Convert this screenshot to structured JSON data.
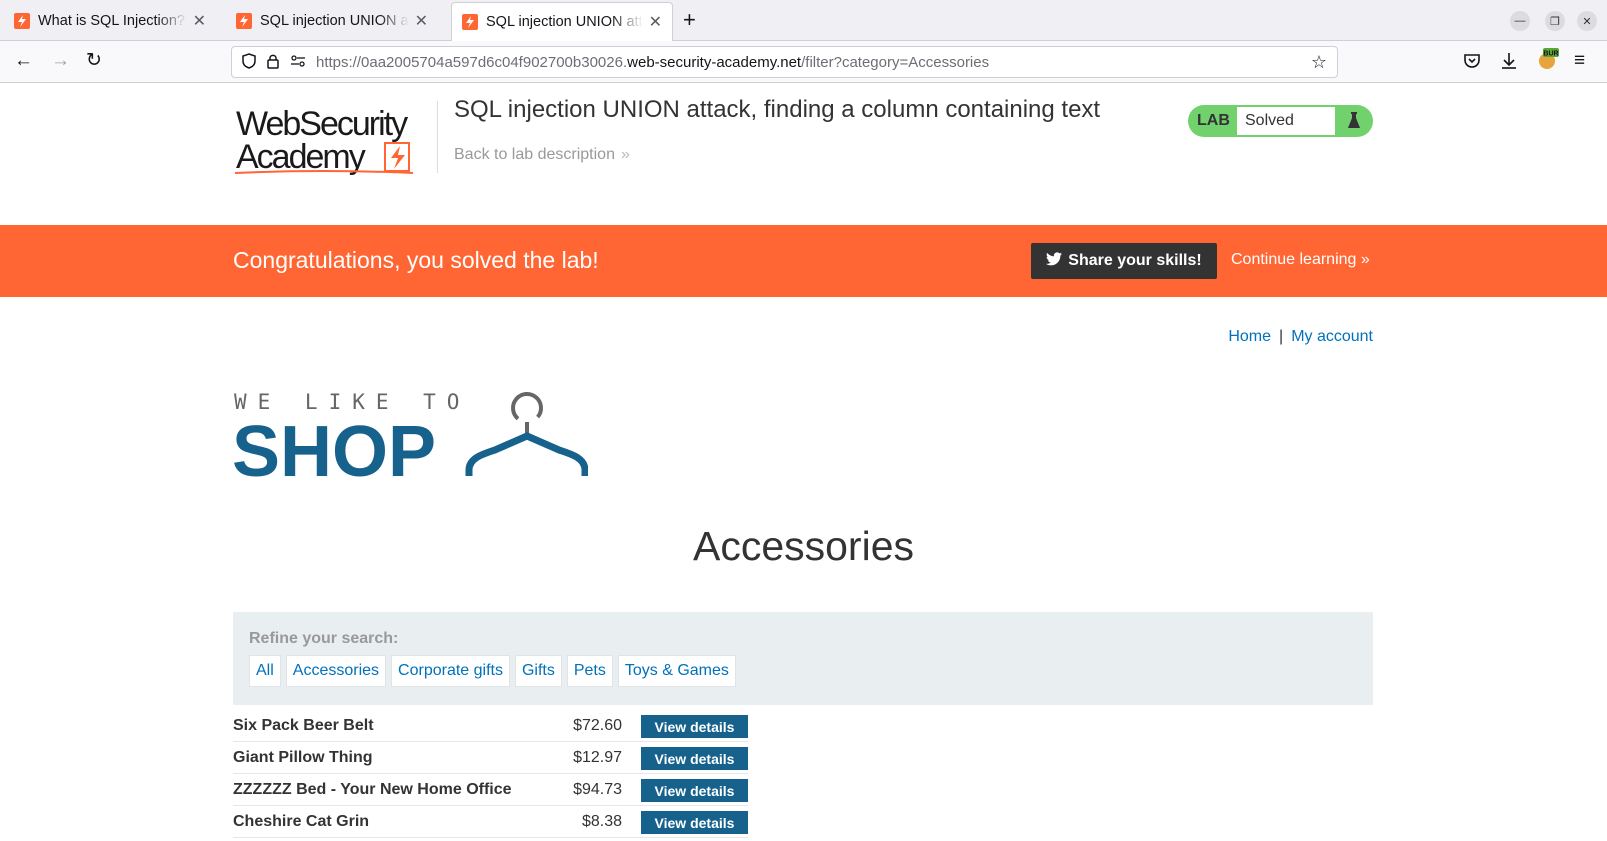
{
  "browser": {
    "tabs": [
      {
        "title": "What is SQL Injection? Tut",
        "active": false
      },
      {
        "title": "SQL injection UNION atta",
        "active": false
      },
      {
        "title": "SQL injection UNION atta",
        "active": true
      }
    ],
    "url": {
      "prefix": "https://0aa2005704a597d6c04f902700b30026.",
      "host": "web-security-academy.net",
      "path": "/filter?category=Accessories"
    },
    "extension_badge": "BUR"
  },
  "lab": {
    "logo": {
      "line1": "WebSecurity",
      "line2": "Academy"
    },
    "title": "SQL injection UNION attack, finding a column containing text",
    "back_link": "Back to lab description",
    "status_label": "LAB",
    "status_value": "Solved",
    "status_color": "#70d16d"
  },
  "banner": {
    "message": "Congratulations, you solved the lab!",
    "share_button": "Share your skills!",
    "continue_link": "Continue learning",
    "color": "#ff6633"
  },
  "nav": {
    "home": "Home",
    "separator": "|",
    "account": "My account"
  },
  "shop_logo": {
    "tagline": "WE LIKE TO",
    "word": "SHOP"
  },
  "category_heading": "Accessories",
  "refine": {
    "label": "Refine your search:",
    "filters": [
      "All",
      "Accessories",
      "Corporate gifts",
      "Gifts",
      "Pets",
      "Toys & Games"
    ]
  },
  "products": [
    {
      "name": "Six Pack Beer Belt",
      "price": "$72.60",
      "button": "View details"
    },
    {
      "name": "Giant Pillow Thing",
      "price": "$12.97",
      "button": "View details"
    },
    {
      "name": "ZZZZZZ Bed - Your New Home Office",
      "price": "$94.73",
      "button": "View details"
    },
    {
      "name": "Cheshire Cat Grin",
      "price": "$8.38",
      "button": "View details"
    }
  ],
  "colors": {
    "link": "#0071bc",
    "button": "#17628c",
    "accent": "#ff6633"
  }
}
